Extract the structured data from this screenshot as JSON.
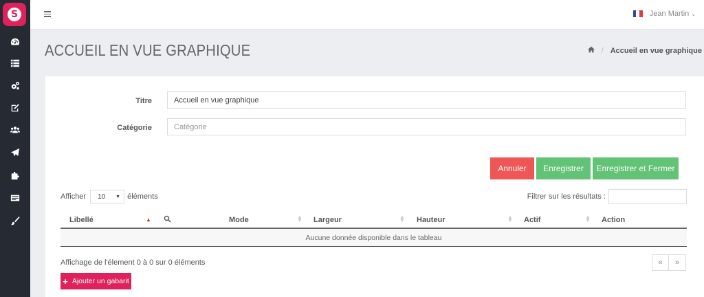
{
  "app": {
    "logo_letter": "S"
  },
  "sidebar": {
    "items": [
      {
        "icon": "dashboard-icon"
      },
      {
        "icon": "list-icon"
      },
      {
        "icon": "cogs-icon"
      },
      {
        "icon": "edit-icon"
      },
      {
        "icon": "users-icon"
      },
      {
        "icon": "send-icon"
      },
      {
        "icon": "puzzle-icon"
      },
      {
        "icon": "card-icon"
      },
      {
        "icon": "brush-icon"
      }
    ]
  },
  "topbar": {
    "user_name": "Jean Martin",
    "flag": "france-flag"
  },
  "page": {
    "title": "ACCUEIL EN VUE GRAPHIQUE",
    "breadcrumb_current": "Accueil en vue graphique",
    "breadcrumb_sep": "/"
  },
  "form": {
    "titre_label": "Titre",
    "titre_value": "Accueil en vue graphique",
    "categorie_label": "Catégorie",
    "categorie_placeholder": "Catégorie"
  },
  "actions": {
    "cancel": "Annuler",
    "save": "Enregistrer",
    "save_close": "Enregistrer et Fermer"
  },
  "table_controls": {
    "show_prefix": "Afficher",
    "page_size": "10",
    "show_suffix": "éléments",
    "filter_label": "Filtrer sur les résultats :"
  },
  "table": {
    "columns": [
      "Libellé",
      "Mode",
      "Largeur",
      "Hauteur",
      "Actif",
      "Action"
    ],
    "empty_text": "Aucune donnée disponible dans le tableau"
  },
  "pagination": {
    "info": "Affichage de l'élement 0 à 0 sur 0 éléments",
    "prev": "«",
    "next": "»"
  },
  "add_button": "Ajouter un gabarit",
  "colors": {
    "brand": "#e0225c",
    "sidebar": "#252a33",
    "danger": "#ef5656",
    "success": "#62c275"
  }
}
